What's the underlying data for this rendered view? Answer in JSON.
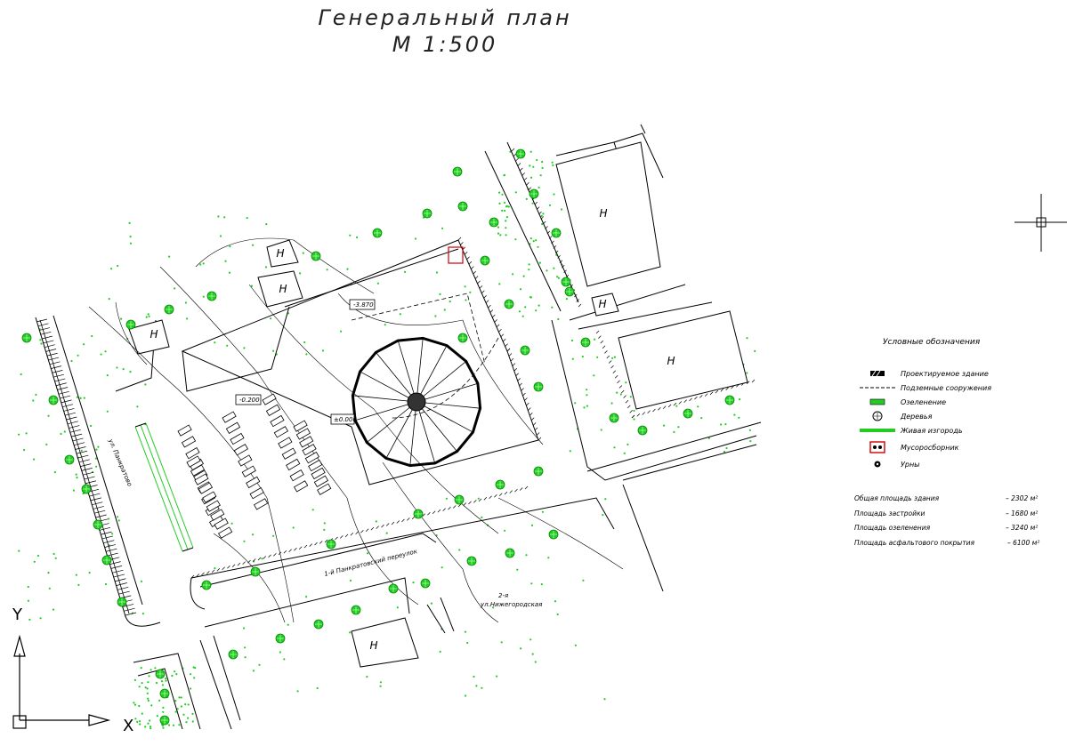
{
  "title": {
    "line1": "Генеральный план",
    "line2": "М 1:500"
  },
  "building_label": "Н",
  "elevations": [
    "-3.870",
    "-0.200",
    "±0.000"
  ],
  "streets": {
    "left": "ул. Панкратово",
    "lane": "1-й Панкратовский переулок",
    "bottom_line1": "2-я",
    "bottom_line2": "ул.Нижегородская"
  },
  "axes": {
    "x": "X",
    "y": "Y"
  },
  "legend": {
    "title": "Условные обозначения",
    "items": [
      {
        "label": "Проектируемое здание",
        "icon": "building-hatch-icon"
      },
      {
        "label": "Подземные сооружения",
        "icon": "dashed-line-icon"
      },
      {
        "label": "Озеленение",
        "icon": "greenery-icon"
      },
      {
        "label": "Деревья",
        "icon": "tree-icon"
      },
      {
        "label": "Живая изгородь",
        "icon": "hedge-icon"
      },
      {
        "label": "Мусоросборник",
        "icon": "garbage-bin-icon"
      },
      {
        "label": "Урны",
        "icon": "urn-icon"
      }
    ]
  },
  "stats": [
    {
      "label": "Общая площадь здания",
      "value": "– 2302 м²"
    },
    {
      "label": "Площадь застройки",
      "value": "– 1680 м²"
    },
    {
      "label": "Площадь озеленения",
      "value": "– 3240 м²"
    },
    {
      "label": "Площадь асфальтового покрытия",
      "value": "– 6100 м²"
    }
  ],
  "colors": {
    "green": "#22cc22",
    "red": "#cc0000",
    "line": "#000000"
  }
}
